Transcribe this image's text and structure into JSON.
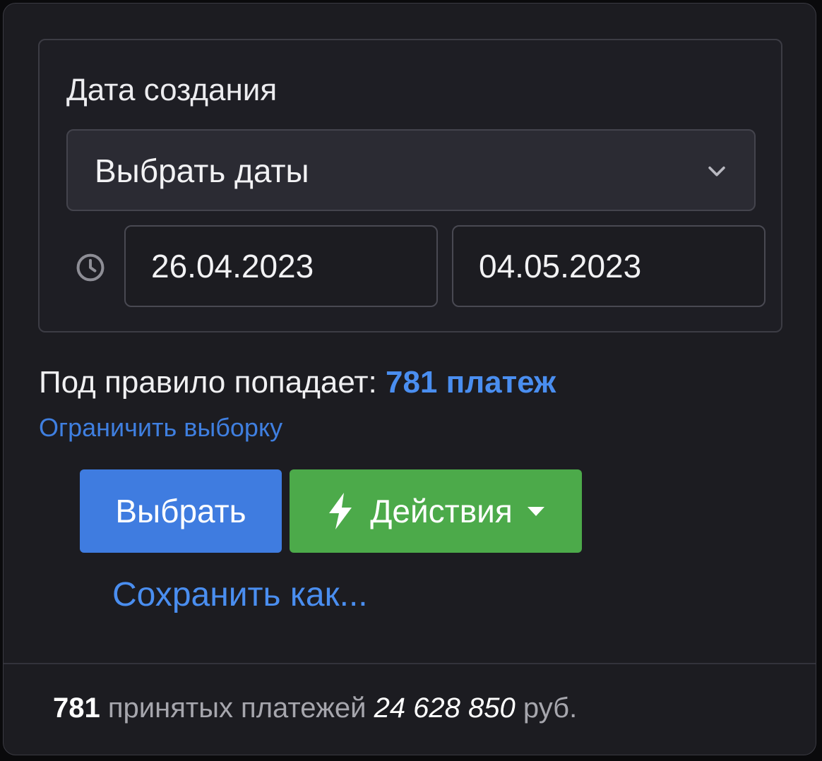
{
  "filter": {
    "label": "Дата создания",
    "period_select": {
      "value": "Выбрать даты",
      "icon": "chevron-down-icon"
    },
    "date_from": "26.04.2023",
    "date_to": "04.05.2023",
    "clock_icon": "clock-icon"
  },
  "rule": {
    "prefix": "Под правило попадает:",
    "count_text": "781 платеж",
    "limit_link": "Ограничить выборку"
  },
  "actions": {
    "select_label": "Выбрать",
    "actions_label": "Действия",
    "actions_icon": "bolt-icon",
    "save_as_label": "Сохранить как..."
  },
  "summary": {
    "count": "781",
    "count_label": "принятых платежей",
    "amount": "24 628 850",
    "currency": "руб."
  },
  "colors": {
    "accent_blue": "#3f7ce0",
    "link_blue": "#4a8ef0",
    "accent_green": "#4caa4a",
    "panel_bg": "#1c1c21"
  }
}
